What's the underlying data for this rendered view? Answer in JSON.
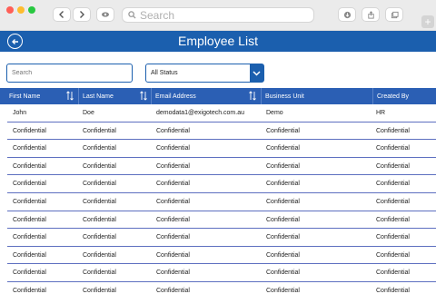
{
  "browser": {
    "search_placeholder": "Search"
  },
  "app": {
    "title": "Employee List"
  },
  "filters": {
    "search_placeholder": "Search",
    "status_value": "All Status"
  },
  "table": {
    "headers": [
      "First Name",
      "Last Name",
      "Email Address",
      "Business Unit",
      "Created By"
    ],
    "rows": [
      [
        "John",
        "Doe",
        "demodata1@exigotech.com.au",
        "Demo",
        "HR"
      ],
      [
        "Confidential",
        "Confidential",
        "Confidential",
        "Confidential",
        "Confidential"
      ],
      [
        "Confidential",
        "Confidential",
        "Confidential",
        "Confidential",
        "Confidential"
      ],
      [
        "Confidential",
        "Confidential",
        "Confidential",
        "Confidential",
        "Confidential"
      ],
      [
        "Confidential",
        "Confidential",
        "Confidential",
        "Confidential",
        "Confidential"
      ],
      [
        "Confidential",
        "Confidential",
        "Confidential",
        "Confidential",
        "Confidential"
      ],
      [
        "Confidential",
        "Confidential",
        "Confidential",
        "Confidential",
        "Confidential"
      ],
      [
        "Confidential",
        "Confidential",
        "Confidential",
        "Confidential",
        "Confidential"
      ],
      [
        "Confidential",
        "Confidential",
        "Confidential",
        "Confidential",
        "Confidential"
      ],
      [
        "Confidential",
        "Confidential",
        "Confidential",
        "Confidential",
        "Confidential"
      ],
      [
        "Confidential",
        "Confidential",
        "Confidential",
        "Confidential",
        "Confidential"
      ]
    ]
  },
  "colors": {
    "header_blue": "#1b5fae",
    "table_header": "#2b5fb4"
  }
}
